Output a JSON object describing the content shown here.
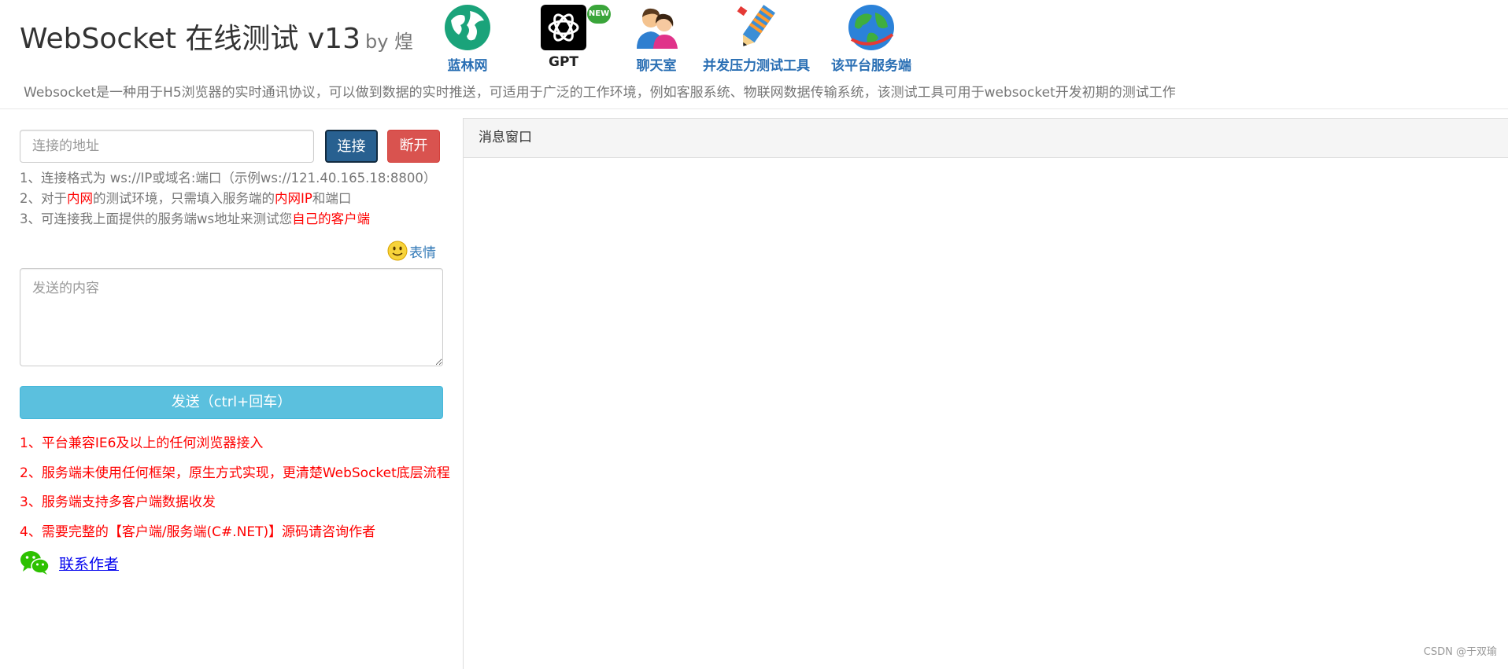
{
  "header": {
    "title": "WebSocket 在线测试 v13",
    "by": "by 煌",
    "nav": [
      {
        "label": "蓝林网",
        "icon": "globe-icon"
      },
      {
        "label": "GPT",
        "icon": "openai-icon",
        "badge": "NEW"
      },
      {
        "label": "聊天室",
        "icon": "chat-users-icon"
      },
      {
        "label": "并发压力测试工具",
        "icon": "pencil-ruler-icon"
      },
      {
        "label": "该平台服务端",
        "icon": "earth-server-icon"
      }
    ],
    "description": "Websocket是一种用于H5浏览器的实时通讯协议，可以做到数据的实时推送，可适用于广泛的工作环境，例如客服系统、物联网数据传输系统，该测试工具可用于websocket开发初期的测试工作"
  },
  "connect": {
    "placeholder": "连接的地址",
    "connect_label": "连接",
    "disconnect_label": "断开"
  },
  "hints": {
    "h1": "1、连接格式为 ws://IP或域名:端口（示例ws://121.40.165.18:8800）",
    "h2_a": "2、对于",
    "h2_b": "内网",
    "h2_c": "的测试环境，只需填入服务端的",
    "h2_d": "内网IP",
    "h2_e": "和端口",
    "h3_a": "3、可连接我上面提供的服务端ws地址来测试您",
    "h3_b": "自己的客户端"
  },
  "send": {
    "emoji_label": "表情",
    "placeholder": "发送的内容",
    "send_label": "发送（ctrl+回车）"
  },
  "features": [
    "1、平台兼容IE6及以上的任何浏览器接入",
    "2、服务端未使用任何框架，原生方式实现，更清楚WebSocket底层流程",
    "3、服务端支持多客户端数据收发",
    "4、需要完整的【客户端/服务端(C#.NET)】源码请咨询作者"
  ],
  "contact_label": "联系作者",
  "panel": {
    "title": "消息窗口"
  },
  "watermark": "CSDN @于双瑜",
  "colors": {
    "primary": "#286090",
    "danger": "#d9534f",
    "info": "#5bc0de",
    "highlight": "#ff0000",
    "nav": "#2a6fb4"
  }
}
